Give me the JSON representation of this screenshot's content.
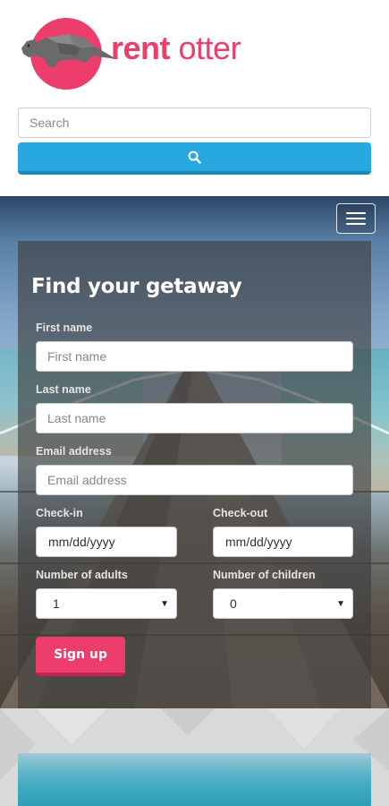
{
  "header": {
    "logo": {
      "word1": "rent",
      "word2": "otter"
    },
    "search": {
      "placeholder": "Search"
    },
    "search_button": {
      "icon": "search-icon"
    }
  },
  "hero": {
    "menu": {
      "icon": "hamburger-menu-icon"
    },
    "form": {
      "title": "Find your getaway",
      "first_name": {
        "label": "First name",
        "placeholder": "First name"
      },
      "last_name": {
        "label": "Last name",
        "placeholder": "Last name"
      },
      "email": {
        "label": "Email address",
        "placeholder": "Email address"
      },
      "check_in": {
        "label": "Check-in",
        "value": "mm/dd/yyyy"
      },
      "check_out": {
        "label": "Check-out",
        "value": "mm/dd/yyyy"
      },
      "adults": {
        "label": "Number of adults",
        "value": "1"
      },
      "children": {
        "label": "Number of children",
        "value": "0"
      },
      "submit_label": "Sign up"
    }
  },
  "colors": {
    "brand": "#ec3d6c",
    "search_button": "#28a8e0"
  }
}
